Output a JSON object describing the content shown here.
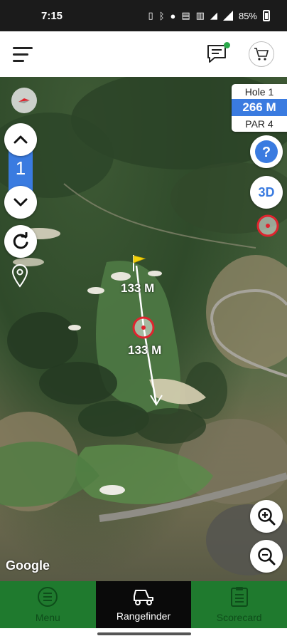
{
  "status_bar": {
    "time": "7:15",
    "battery": "85%"
  },
  "hole_info": {
    "hole_label": "Hole 1",
    "distance": "266 M",
    "par": "PAR 4"
  },
  "hole_stepper": {
    "current": "1"
  },
  "map": {
    "flag_distance": "133 M",
    "target_distance": "133 M",
    "provider": "Google",
    "btn_3d": "3D",
    "help": "?"
  },
  "bottom_nav": {
    "items": [
      {
        "label": "Menu",
        "icon": "menu-circle-icon"
      },
      {
        "label": "Rangefinder",
        "icon": "golf-cart-icon"
      },
      {
        "label": "Scorecard",
        "icon": "scorecard-icon"
      }
    ]
  },
  "colors": {
    "accent_blue": "#3a7be0",
    "nav_green": "#1f7a2e",
    "target_red": "#e0242e",
    "flag_yellow": "#f2d20a"
  }
}
